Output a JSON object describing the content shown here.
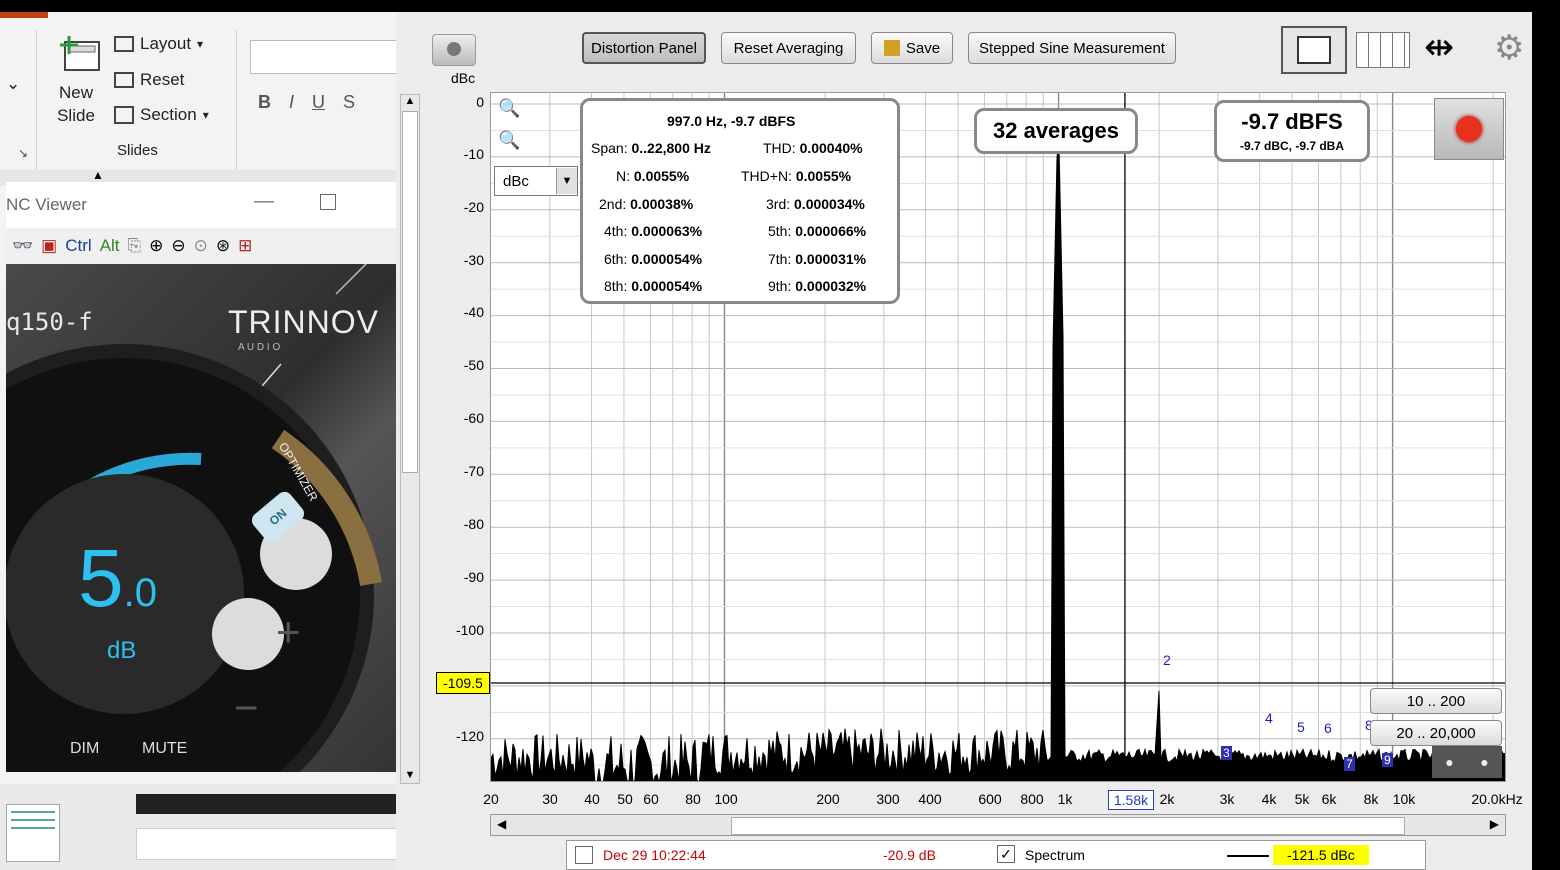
{
  "ppt": {
    "new_slide": "New Slide",
    "layout": "Layout",
    "reset": "Reset",
    "section": "Section",
    "group_label": "Slides",
    "format": [
      "B",
      "I",
      "U",
      "S"
    ]
  },
  "vnc": {
    "title": "NC Viewer",
    "toolbar": {
      "ctrl": "Ctrl",
      "alt": "Alt"
    },
    "device_name": "q150-f",
    "brand": "TRINNOV",
    "brand_sub": "A U D I O",
    "volume_main": "5",
    "volume_dec": ".0",
    "volume_unit": "dB",
    "optimizer": "OPTIMIZER",
    "on": "ON",
    "dim": "DIM",
    "mute": "MUTE"
  },
  "rew": {
    "buttons": {
      "distortion_panel": "Distortion Panel",
      "reset_averaging": "Reset Averaging",
      "save": "Save",
      "stepped_sine": "Stepped Sine Measurement"
    },
    "y_unit": "dBc",
    "unit_select": "dBc",
    "y_ticks": [
      "0",
      "-10",
      "-20",
      "-30",
      "-40",
      "-50",
      "-60",
      "-70",
      "-80",
      "-90",
      "-100",
      "-120"
    ],
    "x_ticks": [
      "20",
      "30",
      "40",
      "50",
      "60",
      "80",
      "100",
      "200",
      "300",
      "400",
      "600",
      "800",
      "1k",
      "2k",
      "3k",
      "4k",
      "5k",
      "6k",
      "8k",
      "10k",
      "20.0kHz"
    ],
    "cursor_x": "1.58k",
    "cursor_y": "-109.5",
    "panel": {
      "header": "997.0 Hz, -9.7 dBFS",
      "span_label": "Span:",
      "span": "0..22,800 Hz",
      "thd_label": "THD:",
      "thd": "0.00040%",
      "n_label": "N:",
      "n": "0.0055%",
      "thdn_label": "THD+N:",
      "thdn": "0.0055%",
      "h2_label": "2nd:",
      "h2": "0.00038%",
      "h3_label": "3rd:",
      "h3": "0.000034%",
      "h4_label": "4th:",
      "h4": "0.000063%",
      "h5_label": "5th:",
      "h5": "0.000066%",
      "h6_label": "6th:",
      "h6": "0.000054%",
      "h7_label": "7th:",
      "h7": "0.000031%",
      "h8_label": "8th:",
      "h8": "0.000054%",
      "h9_label": "9th:",
      "h9": "0.000032%"
    },
    "averages": "32 averages",
    "level_main": "-9.7 dBFS",
    "level_sub": "-9.7 dBC, -9.7 dBA",
    "harmonic_labels": [
      "2",
      "4",
      "5",
      "6",
      "8"
    ],
    "harmonic_boxes": [
      "3",
      "7",
      "9"
    ],
    "range_buttons": [
      "10 .. 200",
      "20 .. 20,000"
    ],
    "legend": {
      "date": "Dec 29 10:22:44",
      "level": "-20.9 dB",
      "name": "Spectrum",
      "value": "-121.5 dBc"
    },
    "colors": {
      "highlight": "#ffff00",
      "record": "#e8321e",
      "legend_red": "#cc0000"
    }
  }
}
